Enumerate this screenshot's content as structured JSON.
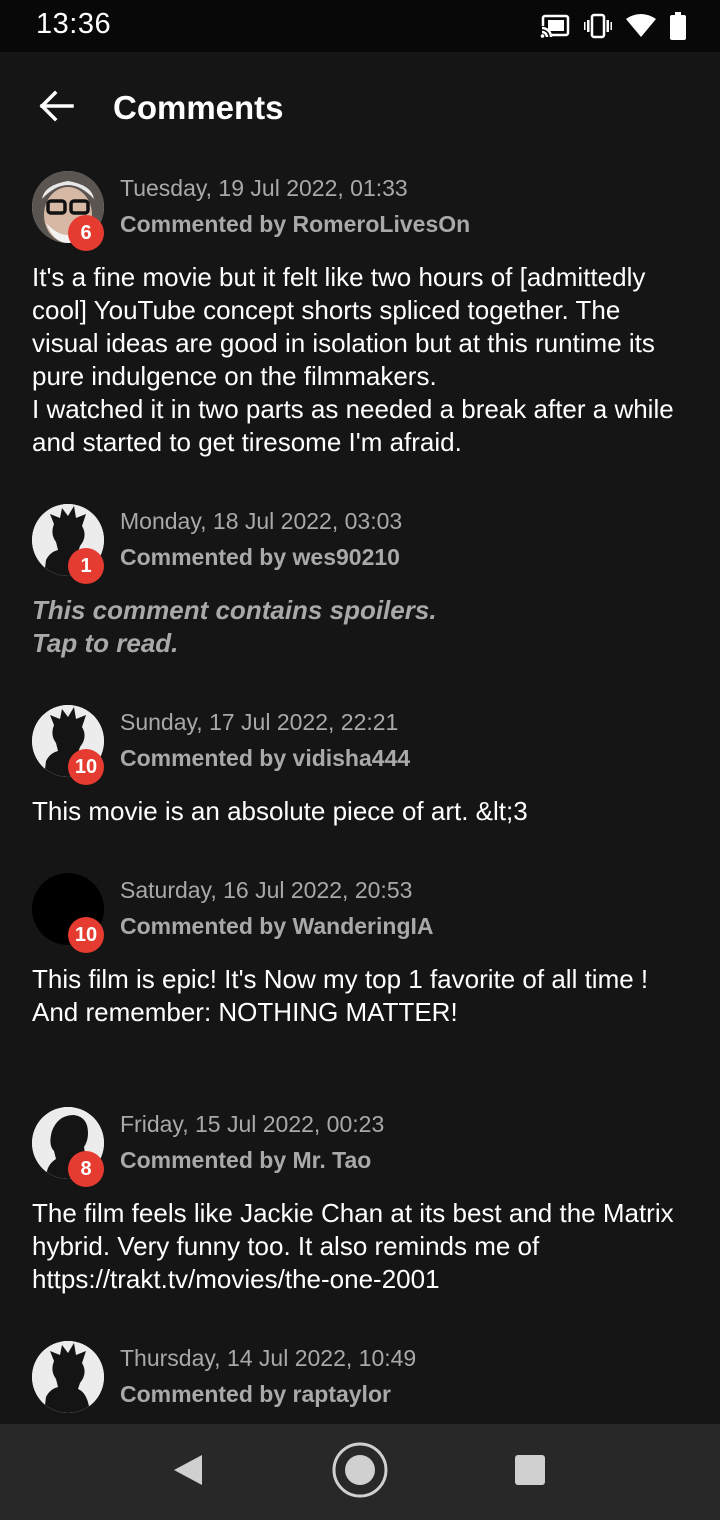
{
  "status_bar": {
    "time": "13:36",
    "icons": [
      "cast-icon",
      "vibrate-icon",
      "wifi-icon",
      "battery-icon"
    ]
  },
  "header": {
    "back_icon": "arrow-back-icon",
    "title": "Comments"
  },
  "comments": [
    {
      "date": "Tuesday, 19 Jul 2022, 01:33",
      "user": "Commented by RomeroLivesOn",
      "rating": "6",
      "avatar": "photo",
      "text": "It's a fine movie but it felt like two hours of [admittedly cool] YouTube concept shorts spliced together. The visual ideas are good in isolation but at this runtime its pure indulgence on the filmmakers.\nI watched it in two parts as needed a break after a while and started to get tiresome I'm afraid.",
      "spoiler": false
    },
    {
      "date": "Monday, 18 Jul 2022, 03:03",
      "user": "Commented by wes90210",
      "rating": "1",
      "avatar": "default-silhouette",
      "text": "This comment contains spoilers.\nTap to read.",
      "spoiler": true
    },
    {
      "date": "Sunday, 17 Jul 2022, 22:21",
      "user": "Commented by vidisha444",
      "rating": "10",
      "avatar": "default-silhouette",
      "text": "This movie is an absolute piece of art. &lt;3",
      "spoiler": false
    },
    {
      "date": "Saturday, 16 Jul 2022, 20:53",
      "user": "Commented by WanderingIA",
      "rating": "10",
      "avatar": "black",
      "text": "This film is epic! It's Now my top 1 favorite of all time !\nAnd remember: NOTHING MATTER!",
      "spoiler": false
    },
    {
      "date": "Friday, 15 Jul 2022, 00:23",
      "user": "Commented by Mr. Tao",
      "rating": "8",
      "avatar": "profile-silhouette",
      "text": "The film feels like Jackie Chan at its best and the Matrix hybrid. Very funny too. It also reminds me of https://trakt.tv/movies/the-one-2001",
      "spoiler": false
    },
    {
      "date": "Thursday, 14 Jul 2022, 10:49",
      "user": "Commented by raptaylor",
      "rating": "",
      "avatar": "default-silhouette",
      "text": "",
      "spoiler": false
    }
  ],
  "nav_bar": {
    "icons": [
      "nav-back-icon",
      "nav-home-icon",
      "nav-recents-icon"
    ]
  },
  "colors": {
    "background": "#151515",
    "status_bar": "#080808",
    "nav_bar": "#282828",
    "badge": "#e53b30",
    "secondary_text": "#a9a9a9"
  }
}
